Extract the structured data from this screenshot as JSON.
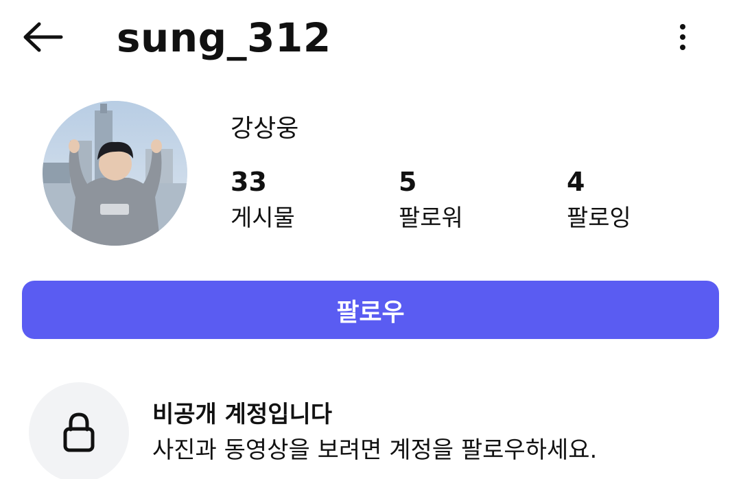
{
  "header": {
    "back_icon": "arrow-left-icon",
    "username": "sung_312",
    "more_icon": "more-vertical-icon"
  },
  "profile": {
    "avatar": "profile-photo",
    "display_name": "강상웅",
    "stats": [
      {
        "value": "33",
        "label": "게시물"
      },
      {
        "value": "5",
        "label": "팔로워"
      },
      {
        "value": "4",
        "label": "팔로잉"
      }
    ]
  },
  "follow_button": {
    "label": "팔로우",
    "color": "#5a5cf2"
  },
  "private_notice": {
    "icon": "lock-icon",
    "title": "비공개 계정입니다",
    "subtitle": "사진과 동영상을 보려면 계정을 팔로우하세요."
  }
}
